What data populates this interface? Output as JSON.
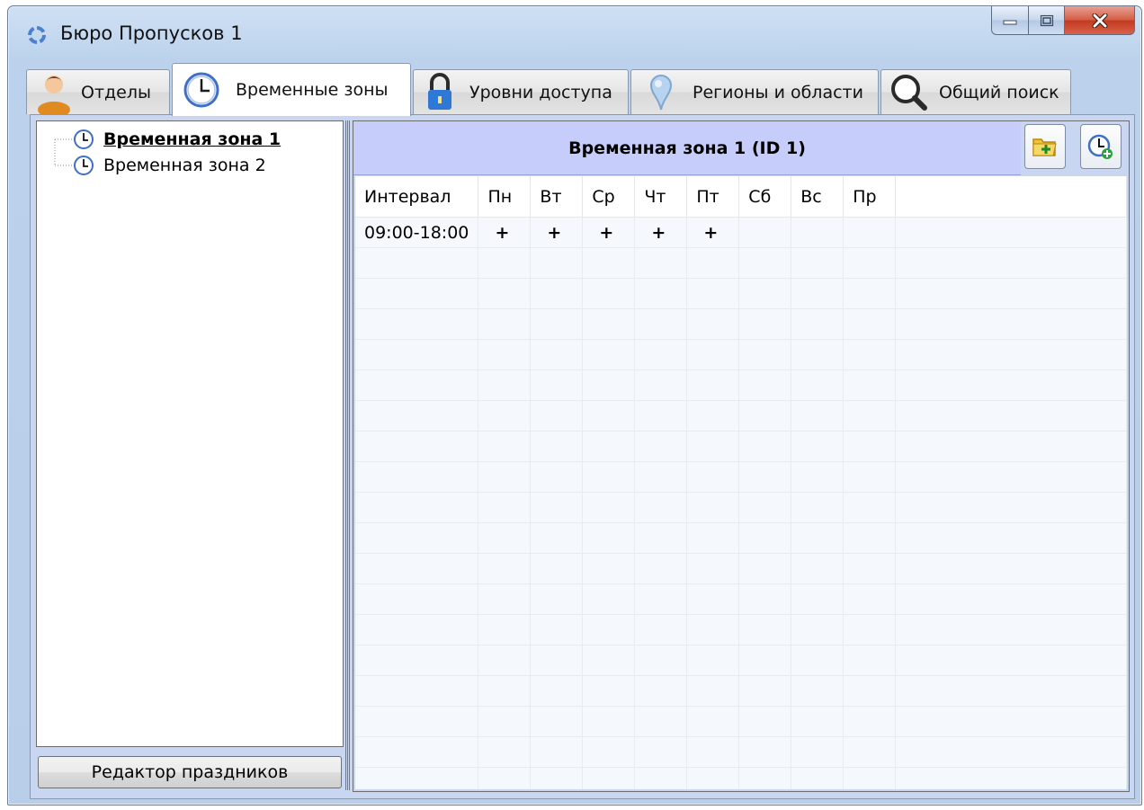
{
  "window": {
    "title": "Бюро Пропусков 1",
    "accent_color": "#c7cdfa"
  },
  "tabs": [
    {
      "label": "Отделы",
      "icon": "person-icon",
      "active": false
    },
    {
      "label": "Временные зоны",
      "icon": "clock-icon",
      "active": true
    },
    {
      "label": "Уровни доступа",
      "icon": "padlock-icon",
      "active": false
    },
    {
      "label": "Регионы и области",
      "icon": "map-pin-icon",
      "active": false
    },
    {
      "label": "Общий поиск",
      "icon": "magnifier-icon",
      "active": false
    }
  ],
  "tree": {
    "items": [
      {
        "label": "Временная зона 1",
        "selected": true
      },
      {
        "label": "Временная зона 2",
        "selected": false
      }
    ]
  },
  "holiday_editor": {
    "label": "Редактор праздников"
  },
  "zone": {
    "header": "Временная зона 1 (ID 1)",
    "columns": [
      "Интервал",
      "Пн",
      "Вт",
      "Ср",
      "Чт",
      "Пт",
      "Сб",
      "Вс",
      "Пр"
    ],
    "rows": [
      [
        "09:00-18:00",
        "+",
        "+",
        "+",
        "+",
        "+",
        "",
        "",
        ""
      ]
    ]
  },
  "toolbar": {
    "add_folder_icon": "folder-add-icon",
    "add_interval_icon": "clock-add-icon"
  }
}
